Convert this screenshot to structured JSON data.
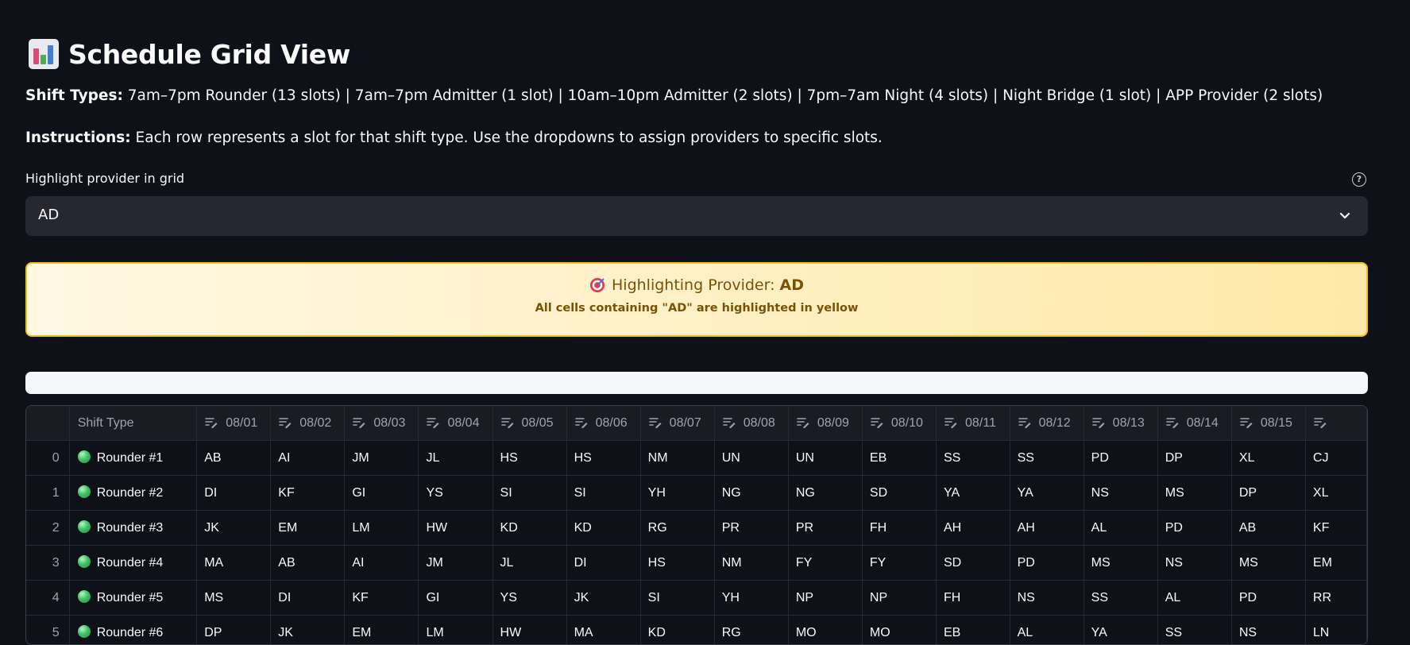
{
  "title": "Schedule Grid View",
  "title_icon": "bar-chart-icon",
  "shift_types": {
    "label": "Shift Types:",
    "text": " 7am–7pm Rounder (13 slots) | 7am–7pm Admitter (1 slot) | 10am–10pm Admitter (2 slots) | 7pm–7am Night (4 slots) | Night Bridge (1 slot) | APP Provider (2 slots)"
  },
  "instructions": {
    "label": "Instructions:",
    "text": " Each row represents a slot for that shift type. Use the dropdowns to assign providers to specific slots."
  },
  "highlight_select": {
    "label": "Highlight provider in grid",
    "value": "AD",
    "help_icon": "question-circle-icon",
    "chevron_icon": "chevron-down-icon"
  },
  "banner": {
    "icon": "dart-target-icon",
    "title_prefix": "Highlighting Provider:",
    "provider": "AD",
    "subtitle": "All cells containing \"AD\" are highlighted in yellow",
    "border_color": "#f2c21b",
    "text_color": "#7a5206"
  },
  "grid": {
    "shift_header": "Shift Type",
    "edit_icon": "edit-column-icon",
    "status_icon": "green-circle-icon",
    "dates": [
      "08/01",
      "08/02",
      "08/03",
      "08/04",
      "08/05",
      "08/06",
      "08/07",
      "08/08",
      "08/09",
      "08/10",
      "08/11",
      "08/12",
      "08/13",
      "08/14",
      "08/15"
    ],
    "rows": [
      {
        "index": "0",
        "shift": "Rounder #1",
        "cells": [
          "AB",
          "AI",
          "JM",
          "JL",
          "HS",
          "HS",
          "NM",
          "UN",
          "UN",
          "EB",
          "SS",
          "SS",
          "PD",
          "DP",
          "XL",
          "CJ"
        ]
      },
      {
        "index": "1",
        "shift": "Rounder #2",
        "cells": [
          "DI",
          "KF",
          "GI",
          "YS",
          "SI",
          "SI",
          "YH",
          "NG",
          "NG",
          "SD",
          "YA",
          "YA",
          "NS",
          "MS",
          "DP",
          "XL"
        ]
      },
      {
        "index": "2",
        "shift": "Rounder #3",
        "cells": [
          "JK",
          "EM",
          "LM",
          "HW",
          "KD",
          "KD",
          "RG",
          "PR",
          "PR",
          "FH",
          "AH",
          "AH",
          "AL",
          "PD",
          "AB",
          "KF"
        ]
      },
      {
        "index": "3",
        "shift": "Rounder #4",
        "cells": [
          "MA",
          "AB",
          "AI",
          "JM",
          "JL",
          "DI",
          "HS",
          "NM",
          "FY",
          "FY",
          "SD",
          "PD",
          "MS",
          "NS",
          "MS",
          "EM"
        ]
      },
      {
        "index": "4",
        "shift": "Rounder #5",
        "cells": [
          "MS",
          "DI",
          "KF",
          "GI",
          "YS",
          "JK",
          "SI",
          "YH",
          "NP",
          "NP",
          "FH",
          "NS",
          "SS",
          "AL",
          "PD",
          "RR"
        ]
      },
      {
        "index": "5",
        "shift": "Rounder #6",
        "cells": [
          "DP",
          "JK",
          "EM",
          "LM",
          "HW",
          "MA",
          "KD",
          "RG",
          "MO",
          "MO",
          "EB",
          "AL",
          "YA",
          "SS",
          "NS",
          "LN"
        ]
      }
    ]
  }
}
